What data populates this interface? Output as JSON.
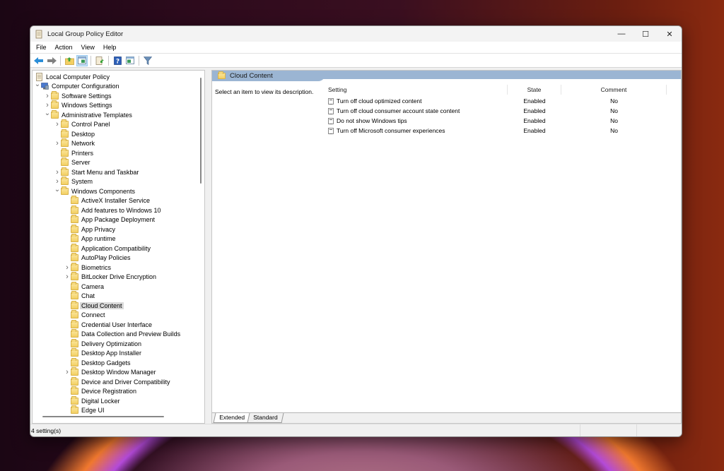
{
  "window": {
    "title": "Local Group Policy Editor",
    "controls": {
      "minimize": "—",
      "maximize": "☐",
      "close": "✕"
    }
  },
  "menu": [
    "File",
    "Action",
    "View",
    "Help"
  ],
  "toolbar": {
    "buttons": [
      "back-icon",
      "forward-icon",
      "up-folder-icon",
      "show-hide-console-tree-icon",
      "export-list-icon",
      "help-icon",
      "show-hide-action-pane-icon",
      "filter-icon"
    ]
  },
  "tree": {
    "items": [
      {
        "label": "Local Computer Policy",
        "level": 0,
        "expander": "",
        "icon": "policy-icon"
      },
      {
        "label": "Computer Configuration",
        "level": 0,
        "expander": "expanded",
        "icon": "computer-icon"
      },
      {
        "label": "Software Settings",
        "level": 1,
        "expander": "collapsed",
        "icon": "folder-icon"
      },
      {
        "label": "Windows Settings",
        "level": 1,
        "expander": "collapsed",
        "icon": "folder-icon"
      },
      {
        "label": "Administrative Templates",
        "level": 1,
        "expander": "expanded",
        "icon": "folder-icon"
      },
      {
        "label": "Control Panel",
        "level": 2,
        "expander": "collapsed",
        "icon": "folder-icon"
      },
      {
        "label": "Desktop",
        "level": 2,
        "expander": "",
        "icon": "folder-icon"
      },
      {
        "label": "Network",
        "level": 2,
        "expander": "collapsed",
        "icon": "folder-icon"
      },
      {
        "label": "Printers",
        "level": 2,
        "expander": "",
        "icon": "folder-icon"
      },
      {
        "label": "Server",
        "level": 2,
        "expander": "",
        "icon": "folder-icon"
      },
      {
        "label": "Start Menu and Taskbar",
        "level": 2,
        "expander": "collapsed",
        "icon": "folder-icon"
      },
      {
        "label": "System",
        "level": 2,
        "expander": "collapsed",
        "icon": "folder-icon"
      },
      {
        "label": "Windows Components",
        "level": 2,
        "expander": "expanded",
        "icon": "folder-icon"
      },
      {
        "label": "ActiveX Installer Service",
        "level": 3,
        "expander": "",
        "icon": "folder-icon"
      },
      {
        "label": "Add features to Windows 10",
        "level": 3,
        "expander": "",
        "icon": "folder-icon"
      },
      {
        "label": "App Package Deployment",
        "level": 3,
        "expander": "",
        "icon": "folder-icon"
      },
      {
        "label": "App Privacy",
        "level": 3,
        "expander": "",
        "icon": "folder-icon"
      },
      {
        "label": "App runtime",
        "level": 3,
        "expander": "",
        "icon": "folder-icon"
      },
      {
        "label": "Application Compatibility",
        "level": 3,
        "expander": "",
        "icon": "folder-icon"
      },
      {
        "label": "AutoPlay Policies",
        "level": 3,
        "expander": "",
        "icon": "folder-icon"
      },
      {
        "label": "Biometrics",
        "level": 3,
        "expander": "collapsed",
        "icon": "folder-icon"
      },
      {
        "label": "BitLocker Drive Encryption",
        "level": 3,
        "expander": "collapsed",
        "icon": "folder-icon"
      },
      {
        "label": "Camera",
        "level": 3,
        "expander": "",
        "icon": "folder-icon"
      },
      {
        "label": "Chat",
        "level": 3,
        "expander": "",
        "icon": "folder-icon"
      },
      {
        "label": "Cloud Content",
        "level": 3,
        "expander": "",
        "icon": "folder-icon",
        "selected": true
      },
      {
        "label": "Connect",
        "level": 3,
        "expander": "",
        "icon": "folder-icon"
      },
      {
        "label": "Credential User Interface",
        "level": 3,
        "expander": "",
        "icon": "folder-icon"
      },
      {
        "label": "Data Collection and Preview Builds",
        "level": 3,
        "expander": "",
        "icon": "folder-icon"
      },
      {
        "label": "Delivery Optimization",
        "level": 3,
        "expander": "",
        "icon": "folder-icon"
      },
      {
        "label": "Desktop App Installer",
        "level": 3,
        "expander": "",
        "icon": "folder-icon"
      },
      {
        "label": "Desktop Gadgets",
        "level": 3,
        "expander": "",
        "icon": "folder-icon"
      },
      {
        "label": "Desktop Window Manager",
        "level": 3,
        "expander": "collapsed",
        "icon": "folder-icon"
      },
      {
        "label": "Device and Driver Compatibility",
        "level": 3,
        "expander": "",
        "icon": "folder-icon"
      },
      {
        "label": "Device Registration",
        "level": 3,
        "expander": "",
        "icon": "folder-icon"
      },
      {
        "label": "Digital Locker",
        "level": 3,
        "expander": "",
        "icon": "folder-icon"
      },
      {
        "label": "Edge UI",
        "level": 3,
        "expander": "",
        "icon": "folder-icon"
      }
    ]
  },
  "details": {
    "header": "Cloud Content",
    "description": "Select an item to view its description.",
    "columns": {
      "setting": "Setting",
      "state": "State",
      "comment": "Comment"
    },
    "rows": [
      {
        "setting": "Turn off cloud optimized content",
        "state": "Enabled",
        "comment": "No"
      },
      {
        "setting": "Turn off cloud consumer account state content",
        "state": "Enabled",
        "comment": "No"
      },
      {
        "setting": "Do not show Windows tips",
        "state": "Enabled",
        "comment": "No"
      },
      {
        "setting": "Turn off Microsoft consumer experiences",
        "state": "Enabled",
        "comment": "No"
      }
    ],
    "tabs": [
      {
        "label": "Extended",
        "active": true
      },
      {
        "label": "Standard",
        "active": false
      }
    ]
  },
  "status": {
    "text": "4 setting(s)"
  },
  "colors": {
    "header_band": "#9bb5d3",
    "selection": "#d9d9d9",
    "folder": "#f3cf62"
  }
}
